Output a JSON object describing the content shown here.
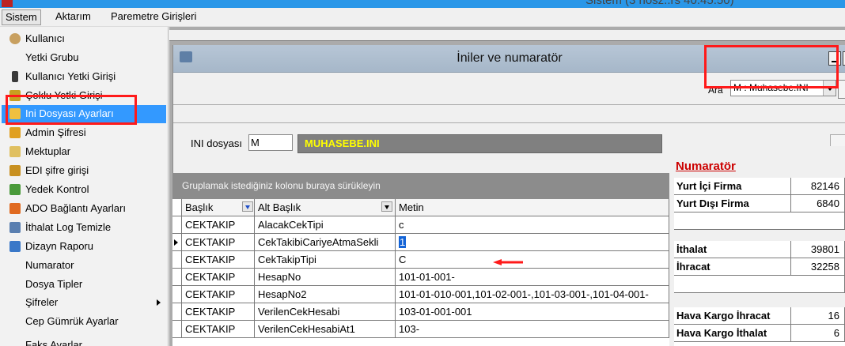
{
  "titlebar": {
    "text": "Sistem (3 riosz..rs 40.45.50)"
  },
  "menubar": {
    "items": [
      "Sistem",
      "Aktarım",
      "Paremetre Girişleri"
    ]
  },
  "dropdown": {
    "items": [
      {
        "label": "Kullanıcı",
        "icon": "user-icon"
      },
      {
        "label": "Yetki Grubu",
        "icon": ""
      },
      {
        "label": "Kullanıcı Yetki Girişi",
        "icon": "user-key-icon"
      },
      {
        "label": "Çoklu Yetki Girişi",
        "icon": "multi-key-icon"
      },
      {
        "label": "Ini Dosyası  Ayarları",
        "icon": "settings-file-icon",
        "selected": true
      },
      {
        "label": "Admin Şifresi",
        "icon": "key-icon"
      },
      {
        "label": "Mektuplar",
        "icon": "letter-icon"
      },
      {
        "label": "EDI şifre girişi",
        "icon": "edi-key-icon"
      },
      {
        "label": "Yedek Kontrol",
        "icon": "backup-icon"
      },
      {
        "label": "ADO Bağlantı Ayarları",
        "icon": "connection-icon"
      },
      {
        "label": "İthalat Log Temizle",
        "icon": "clean-log-icon"
      },
      {
        "label": "Dizayn Raporu",
        "icon": "report-icon"
      },
      {
        "label": "Numarator",
        "icon": ""
      },
      {
        "label": "Dosya Tipler",
        "icon": ""
      },
      {
        "label": "Şifreler",
        "icon": "",
        "submenu": true
      },
      {
        "label": "Cep Gümrük Ayarlar",
        "icon": ""
      },
      {
        "label": "Faks Ayarlar",
        "icon": ""
      }
    ]
  },
  "window": {
    "title": "İniler ve numaratör",
    "ara_label": "Ara",
    "ara_value": "M : Muhasebe.INI",
    "ini_label": "INI dosyası",
    "ini_value": "M",
    "ini_filename": "MUHASEBE.INI",
    "group_hint": "Gruplamak istediğiniz kolonu buraya sürükleyin"
  },
  "grid": {
    "headers": [
      "Başlık",
      "Alt Başlık",
      "Metin"
    ],
    "rows": [
      [
        "CEKTAKIP",
        "AlacakCekTipi",
        "c"
      ],
      [
        "CEKTAKIP",
        "CekTakibiCariyeAtmaSekli",
        "1"
      ],
      [
        "CEKTAKIP",
        "CekTakipTipi",
        "C"
      ],
      [
        "CEKTAKIP",
        "HesapNo",
        "101-01-001-"
      ],
      [
        "CEKTAKIP",
        "HesapNo2",
        "101-01-010-001,101-02-001-,101-03-001-,101-04-001-"
      ],
      [
        "CEKTAKIP",
        "VerilenCekHesabi",
        "103-01-001-001"
      ],
      [
        "CEKTAKIP",
        "VerilenCekHesabiAt1",
        "103-"
      ]
    ],
    "current_row": 1
  },
  "numarator": {
    "title": "Numaratör",
    "group1": [
      {
        "label": "Yurt İçi Firma",
        "value": "82146"
      },
      {
        "label": "Yurt Dışı Firma",
        "value": "6840"
      }
    ],
    "group2": [
      {
        "label": "İthalat",
        "value": "39801"
      },
      {
        "label": "İhracat",
        "value": "32258"
      }
    ],
    "group3": [
      {
        "label": "Hava Kargo İhracat",
        "value": "16"
      },
      {
        "label": "Hava Kargo İthalat",
        "value": "6"
      }
    ]
  },
  "colors": {
    "accent": "#3399ff",
    "highlight_box": "#ff1a1a",
    "ini_file_text": "#ffff00",
    "numarator_title": "#cc0000"
  }
}
